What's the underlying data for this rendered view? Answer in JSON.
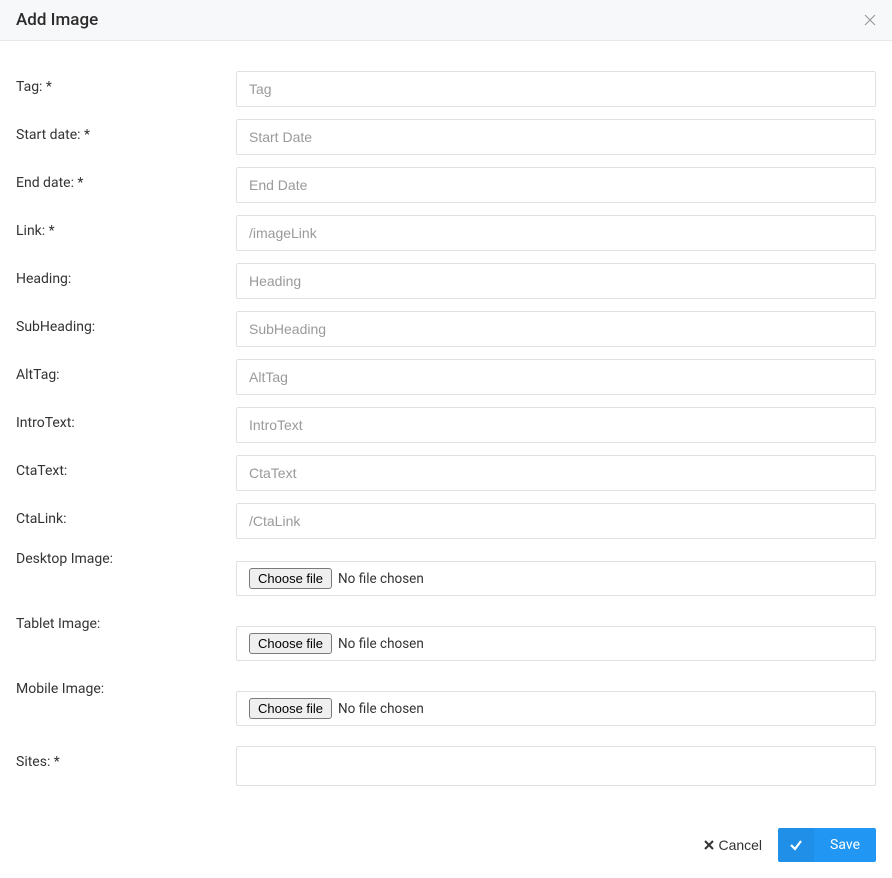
{
  "modal": {
    "title": "Add Image"
  },
  "form": {
    "tag": {
      "label": "Tag: *",
      "placeholder": "Tag"
    },
    "start_date": {
      "label": "Start date: *",
      "placeholder": "Start Date"
    },
    "end_date": {
      "label": "End date: *",
      "placeholder": "End Date"
    },
    "link": {
      "label": "Link: *",
      "placeholder": "/imageLink"
    },
    "heading": {
      "label": "Heading:",
      "placeholder": "Heading"
    },
    "subheading": {
      "label": "SubHeading:",
      "placeholder": "SubHeading"
    },
    "alttag": {
      "label": "AltTag:",
      "placeholder": "AltTag"
    },
    "introtext": {
      "label": "IntroText:",
      "placeholder": "IntroText"
    },
    "ctatext": {
      "label": "CtaText:",
      "placeholder": "CtaText"
    },
    "ctalink": {
      "label": "CtaLink:",
      "placeholder": "/CtaLink"
    },
    "desktop_image": {
      "label": "Desktop Image:",
      "button": "Choose file",
      "status": "No file chosen"
    },
    "tablet_image": {
      "label": "Tablet Image:",
      "button": "Choose file",
      "status": "No file chosen"
    },
    "mobile_image": {
      "label": "Mobile Image:",
      "button": "Choose file",
      "status": "No file chosen"
    },
    "sites": {
      "label": "Sites: *"
    }
  },
  "footer": {
    "cancel": "Cancel",
    "save": "Save"
  }
}
